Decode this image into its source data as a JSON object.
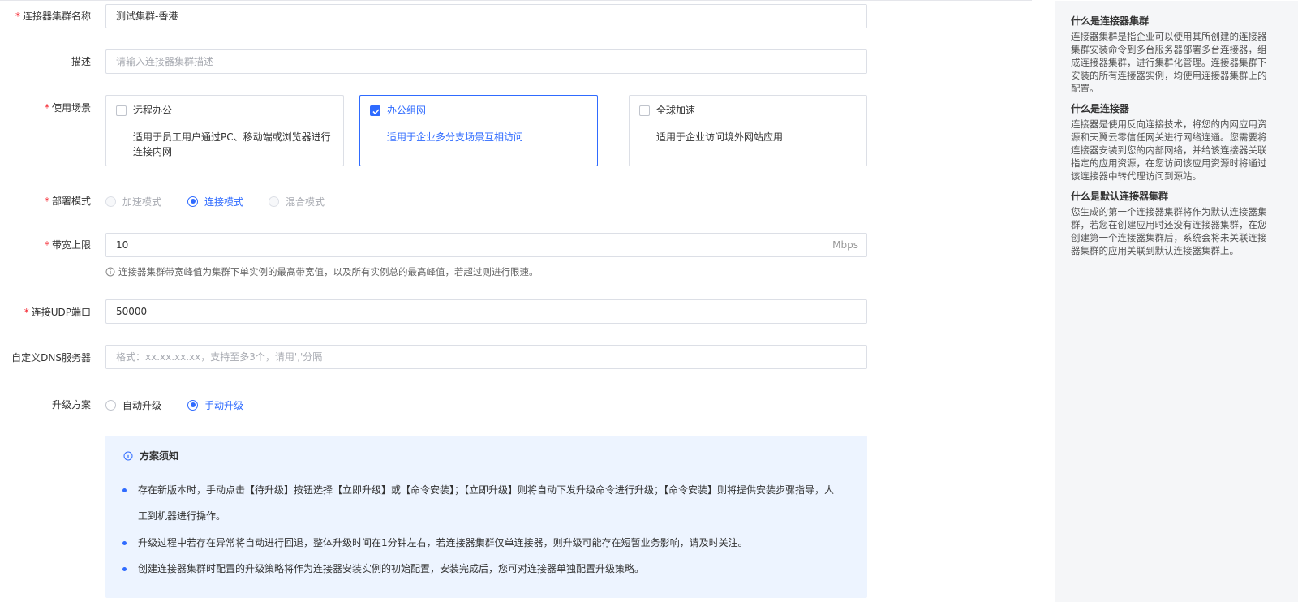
{
  "form": {
    "cluster_name": {
      "label": "连接器集群名称",
      "value": "测试集群-香港"
    },
    "description": {
      "label": "描述",
      "placeholder": "请输入连接器集群描述"
    },
    "scenario": {
      "label": "使用场景",
      "options": [
        {
          "title": "远程办公",
          "desc": "适用于员工用户通过PC、移动端或浏览器进行连接内网",
          "checked": false
        },
        {
          "title": "办公组网",
          "desc": "适用于企业多分支场景互相访问",
          "checked": true
        },
        {
          "title": "全球加速",
          "desc": "适用于企业访问境外网站应用",
          "checked": false
        }
      ]
    },
    "deploy_mode": {
      "label": "部署模式",
      "options": [
        {
          "label": "加速模式",
          "state": "disabled"
        },
        {
          "label": "连接模式",
          "state": "selected"
        },
        {
          "label": "混合模式",
          "state": "disabled"
        }
      ]
    },
    "bandwidth": {
      "label": "带宽上限",
      "value": "10",
      "unit": "Mbps",
      "hint": "连接器集群带宽峰值为集群下单实例的最高带宽值，以及所有实例总的最高峰值，若超过则进行限速。"
    },
    "udp_port": {
      "label": "连接UDP端口",
      "value": "50000"
    },
    "dns": {
      "label": "自定义DNS服务器",
      "placeholder": "格式：xx.xx.xx.xx，支持至多3个，请用','分隔"
    },
    "upgrade": {
      "label": "升级方案",
      "options": [
        {
          "label": "自动升级",
          "state": "unselected"
        },
        {
          "label": "手动升级",
          "state": "selected"
        }
      ]
    },
    "notice": {
      "title": "方案须知",
      "items": [
        "存在新版本时，手动点击【待升级】按钮选择【立即升级】或【命令安装】；【立即升级】则将自动下发升级命令进行升级；【命令安装】则将提供安装步骤指导，人",
        "工到机器进行操作。",
        "升级过程中若存在异常将自动进行回退，整体升级时间在1分钟左右，若连接器集群仅单连接器，则升级可能存在短暂业务影响，请及时关注。",
        "创建连接器集群时配置的升级策略将作为连接器安装实例的初始配置，安装完成后，您可对连接器单独配置升级策略。"
      ]
    }
  },
  "help": [
    {
      "title": "什么是连接器集群",
      "lines": [
        "连接器集群是指企业可以使用其所创建的连接器",
        "集群安装命令到多台服务器部署多台连接器，组",
        "成连接器集群，进行集群化管理。连接器集群下",
        "安装的所有连接器实例，均使用连接器集群上的",
        "配置。"
      ]
    },
    {
      "title": "什么是连接器",
      "lines": [
        "连接器是使用反向连接技术，将您的内网应用资",
        "源和天翼云零信任网关进行网络连通。您需要将",
        "连接器安装到您的内部网络，并给该连接器关联",
        "指定的应用资源，在您访问该应用资源时将通过",
        "该连接器中转代理访问到源站。"
      ]
    },
    {
      "title": "什么是默认连接器集群",
      "lines": [
        "您生成的第一个连接器集群将作为默认连接器集",
        "群，若您在创建应用时还没有连接器集群，在您",
        "创建第一个连接器集群后，系统会将未关联连接",
        "器集群的应用关联到默认连接器集群上。"
      ]
    }
  ],
  "colors": {
    "primary": "#2f6bff",
    "required": "#f5222d",
    "notice_bg": "#edf4ff",
    "side_bg": "#f5f6f8"
  }
}
